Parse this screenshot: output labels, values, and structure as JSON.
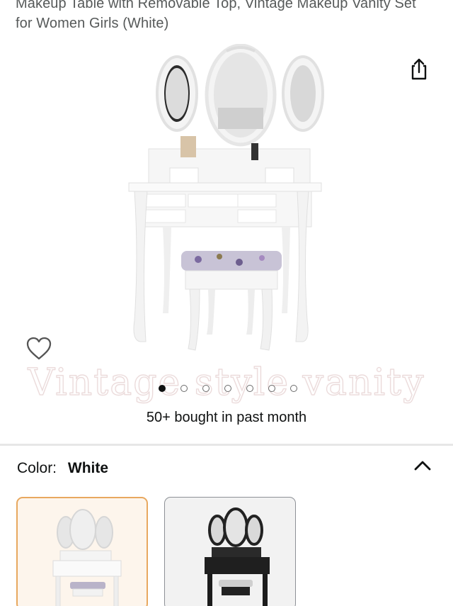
{
  "product": {
    "title_line_1": "Makeup Table with Removable Top, Vintage Makeup Vanity Set",
    "title_line_2": "for Women Girls (White)",
    "image_watermark": "Vintage style vanity",
    "bought_text": "50+ bought in past month"
  },
  "carousel": {
    "dot_count": 7,
    "active_index": 0
  },
  "variation": {
    "label": "Color:",
    "selected_value": "White",
    "options": [
      "White",
      "Black"
    ]
  },
  "colors": {
    "selected_border": "#e8a85f",
    "selected_bg": "#fdf5ec",
    "text_secondary": "#565959",
    "divider": "#e7e7e7"
  },
  "icons": [
    "share-icon",
    "heart-outline-icon",
    "chevron-up-icon"
  ]
}
